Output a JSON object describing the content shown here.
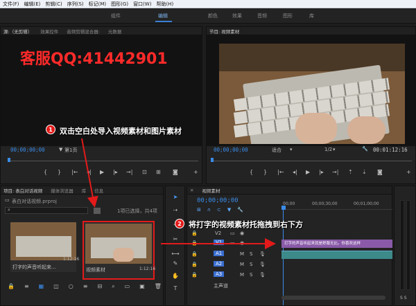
{
  "menu": [
    "文件(F)",
    "编辑(E)",
    "剪辑(C)",
    "序列(S)",
    "标记(M)",
    "图形(G)",
    "窗口(W)",
    "帮助(H)"
  ],
  "workspaces": [
    "组件",
    "编辑",
    "颜色",
    "效果",
    "音频",
    "图形",
    "库"
  ],
  "active_workspace": "编辑",
  "source_panel": {
    "tabs": [
      "源:（无剪辑）",
      "效果控件",
      "音频剪辑混合器:",
      "元数据"
    ],
    "watermark": "客服QQ:41442901",
    "timecode": "00;00;00;00",
    "page": "第1页",
    "end_timecode": "00;00;00;00"
  },
  "program_panel": {
    "title": "节目: 视频素材",
    "timecode": "00;00;00;00",
    "fit": "适合",
    "scale": "1/2",
    "duration": "00:01:12:16"
  },
  "project_panel": {
    "tabs": [
      "项目: 表白对话视频",
      "媒体浏览器",
      "库",
      "信息"
    ],
    "file": "表白对话视频.prproj",
    "selection": "1项已选择，共4项",
    "items": [
      {
        "name": "打字的声音听起来...",
        "duration": "1:12:16"
      },
      {
        "name": "视频素材",
        "duration": "1:12:16"
      }
    ]
  },
  "timeline": {
    "title": "视频素材",
    "timecode": "00;00;00;00",
    "ruler": [
      "00;00",
      "00;00;30;00",
      "00;01;00;00"
    ],
    "tracks": [
      "V2",
      "V1",
      "A1",
      "A2",
      "A3"
    ],
    "master": "主声道",
    "clip_label": "打字的声音听起来就是舒服无比。你喜欢这样"
  },
  "annotations": {
    "step1_num": "1",
    "step1": "双击空白处导入视频素材和图片素材",
    "step2_num": "2",
    "step2": "将打字的视频素材托拖拽到右下方"
  }
}
